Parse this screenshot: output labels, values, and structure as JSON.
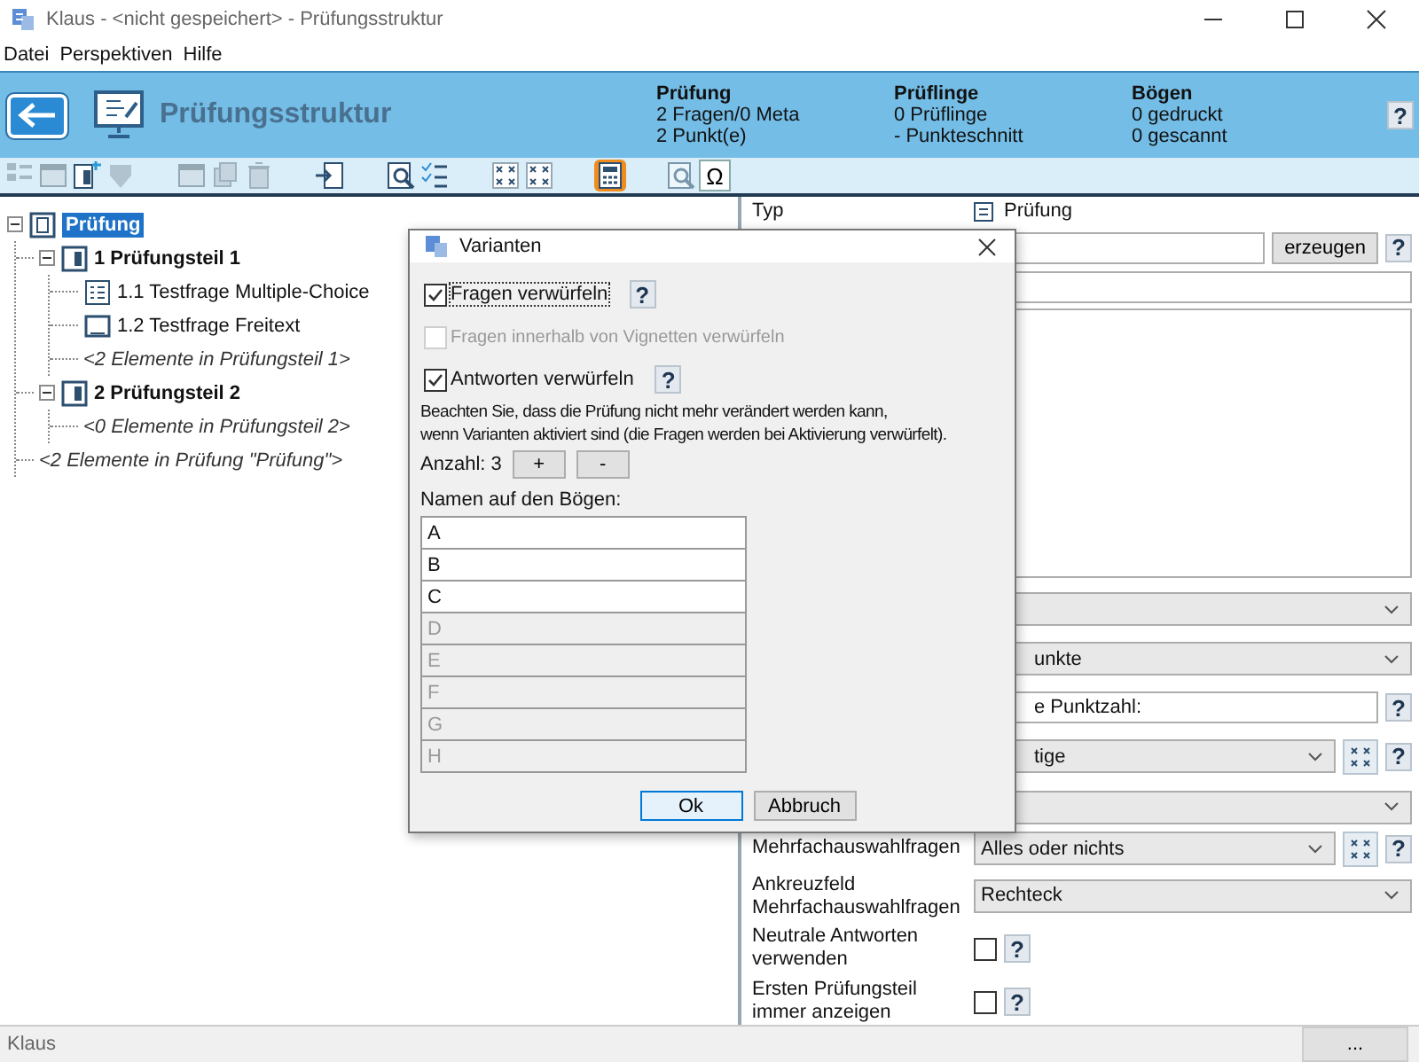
{
  "window": {
    "title": "Klaus - <nicht gespeichert> - Prüfungsstruktur"
  },
  "menu": [
    "Datei",
    "Perspektiven",
    "Hilfe"
  ],
  "header": {
    "title": "Prüfungsstruktur",
    "help": "?",
    "stats": [
      {
        "heading": "Prüfung",
        "lines": [
          "2 Fragen/0 Meta",
          "2 Punkt(e)"
        ]
      },
      {
        "heading": "Prüflinge",
        "lines": [
          "0 Prüflinge",
          "- Punkteschnitt"
        ]
      },
      {
        "heading": "Bögen",
        "lines": [
          "0 gedruckt",
          "0 gescannt"
        ]
      }
    ]
  },
  "toolbar": [
    [
      {
        "kind": "list",
        "disabled": true,
        "selected": false
      },
      {
        "kind": "window",
        "disabled": true,
        "selected": false
      },
      {
        "kind": "page-add",
        "disabled": false,
        "selected": false
      },
      {
        "kind": "shield",
        "disabled": true,
        "selected": false
      }
    ],
    [
      {
        "kind": "window",
        "disabled": true,
        "selected": false
      },
      {
        "kind": "copy",
        "disabled": true,
        "selected": false
      },
      {
        "kind": "trash",
        "disabled": true,
        "selected": false
      }
    ],
    [
      {
        "kind": "import",
        "disabled": false,
        "selected": false
      }
    ],
    [
      {
        "kind": "zoom",
        "disabled": false,
        "selected": false
      },
      {
        "kind": "checklist",
        "disabled": false,
        "selected": false
      }
    ],
    [
      {
        "kind": "grid",
        "disabled": false,
        "selected": false
      },
      {
        "kind": "grid",
        "disabled": false,
        "selected": false
      }
    ],
    [
      {
        "kind": "calculator",
        "disabled": false,
        "selected": true
      }
    ],
    [
      {
        "kind": "zoom",
        "disabled": true,
        "selected": false
      },
      {
        "kind": "omega",
        "label": "Ω",
        "disabled": false,
        "selected": false
      }
    ]
  ],
  "tree": [
    {
      "label": "Prüfung",
      "kind": "exam",
      "expanded": true,
      "selected": true,
      "children": [
        {
          "label": "1 Prüfungsteil 1",
          "kind": "part",
          "expanded": true,
          "selected": false,
          "children": [
            {
              "label": "1.1 Testfrage Multiple-Choice",
              "kind": "mc",
              "selected": false
            },
            {
              "label": "1.2 Testfrage Freitext",
              "kind": "text",
              "selected": false
            },
            {
              "label": "<2 Elemente in Prüfungsteil 1>",
              "kind": "summary",
              "selected": false
            }
          ]
        },
        {
          "label": "2 Prüfungsteil 2",
          "kind": "part",
          "expanded": true,
          "selected": false,
          "children": [
            {
              "label": "<0 Elemente in Prüfungsteil 2>",
              "kind": "summary",
              "selected": false
            }
          ]
        },
        {
          "label": "<2 Elemente in Prüfung \"Prüfung\">",
          "kind": "summary",
          "selected": false
        }
      ]
    }
  ],
  "properties": {
    "type_label": "Typ",
    "type_value": "Prüfung",
    "generate_button": "erzeugen",
    "generate_help": "?",
    "covered_fields": [
      {
        "kind": "combo"
      },
      {
        "kind": "combo",
        "value": "unkte"
      },
      {
        "kind": "text",
        "value": "e Punktzahl:",
        "help": "?"
      },
      {
        "kind": "combo",
        "value": "tige",
        "formula": true,
        "help": "?"
      },
      {
        "kind": "combo"
      }
    ],
    "fields": [
      {
        "label": "Mehrfachauswahlfragen",
        "kind": "combo",
        "value": "Alles oder nichts",
        "formula": true,
        "help": "?"
      },
      {
        "label": "Ankreuzfeld Mehrfachauswahlfragen",
        "kind": "combo",
        "value": "Rechteck"
      },
      {
        "label": "Neutrale Antworten verwenden",
        "kind": "check",
        "checked": false,
        "help": "?"
      },
      {
        "label": "Ersten Prüfungsteil immer anzeigen",
        "kind": "check",
        "checked": false,
        "help": "?"
      }
    ]
  },
  "dialog": {
    "title": "Varianten",
    "options": [
      {
        "label": "Fragen verwürfeln",
        "checked": true,
        "disabled": false,
        "focused": true,
        "help": "?"
      },
      {
        "label": "Fragen innerhalb von Vignetten verwürfeln",
        "checked": false,
        "disabled": true,
        "focused": false
      },
      {
        "label": "Antworten verwürfeln",
        "checked": true,
        "disabled": false,
        "focused": false,
        "help": "?"
      }
    ],
    "note": "Beachten Sie, dass die Prüfung nicht mehr verändert werden kann,\nwenn Varianten aktiviert sind (die Fragen werden bei Aktivierung verwürfelt).",
    "count_label": "Anzahl: 3",
    "plus": "+",
    "minus": "-",
    "names_label": "Namen auf den Bögen:",
    "names": [
      {
        "value": "A",
        "disabled": false
      },
      {
        "value": "B",
        "disabled": false
      },
      {
        "value": "C",
        "disabled": false
      },
      {
        "value": "D",
        "disabled": true
      },
      {
        "value": "E",
        "disabled": true
      },
      {
        "value": "F",
        "disabled": true
      },
      {
        "value": "G",
        "disabled": true
      },
      {
        "value": "H",
        "disabled": true
      }
    ],
    "buttons": [
      {
        "label": "Ok",
        "selected": true
      },
      {
        "label": "Abbruch",
        "selected": false
      }
    ]
  },
  "status_bar": {
    "text": "Klaus",
    "button": "..."
  }
}
